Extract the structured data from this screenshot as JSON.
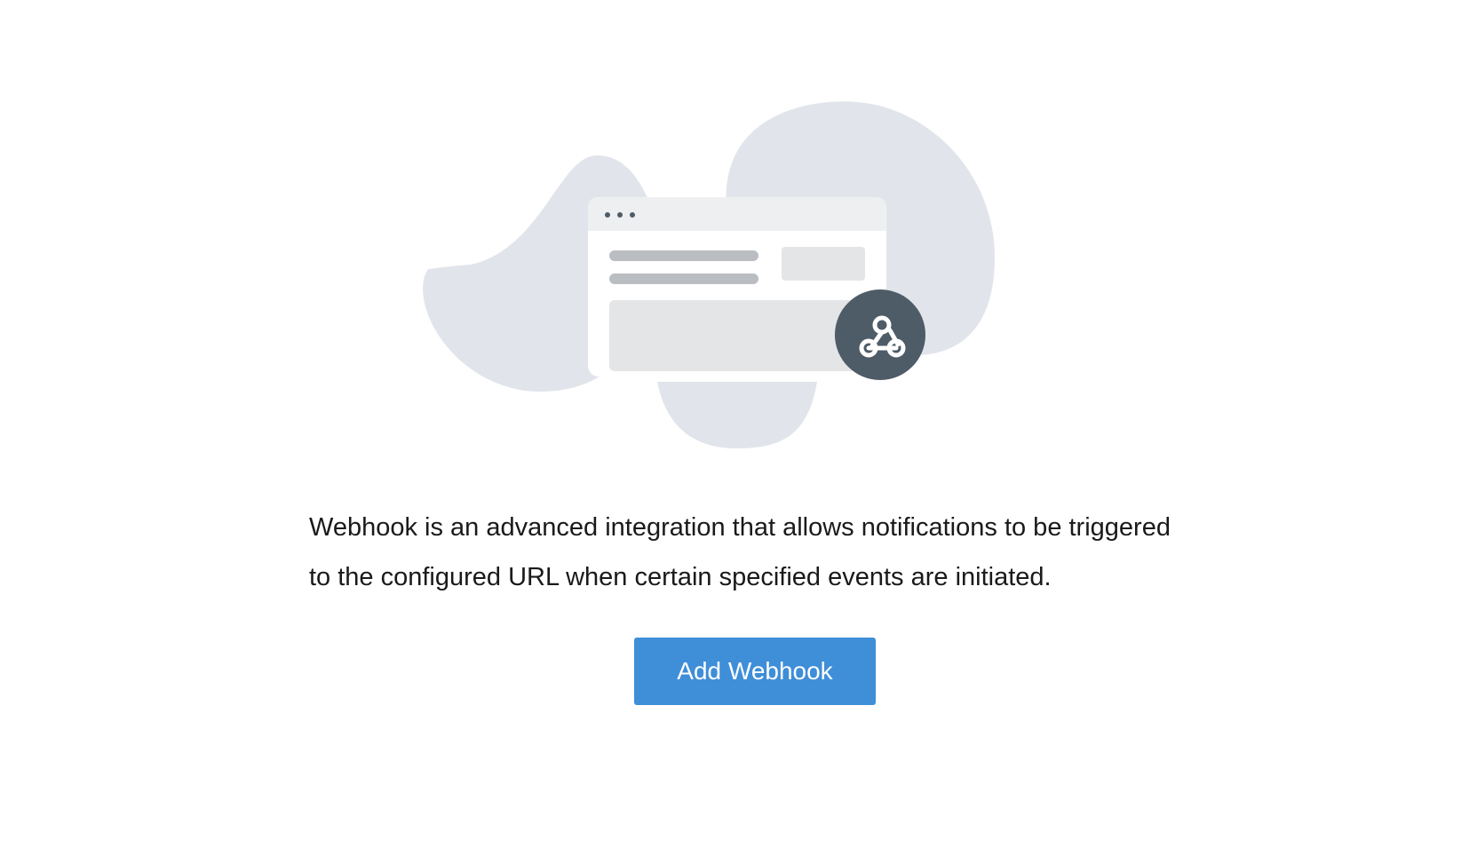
{
  "empty_state": {
    "description": "Webhook is an advanced integration that allows notifications to be triggered to the configured URL when certain specified events are initiated.",
    "add_button_label": "Add Webhook",
    "illustration_icon": "webhook-icon"
  },
  "colors": {
    "blob": "#e1e5eb",
    "window_bg": "#ffffff",
    "window_header": "#eeeff1",
    "skeleton_line": "#babdc2",
    "skeleton_block": "#e4e5e7",
    "badge": "#4e5c68",
    "button": "#3e8ed8",
    "button_text": "#ffffff",
    "text": "#1a1a1a"
  }
}
